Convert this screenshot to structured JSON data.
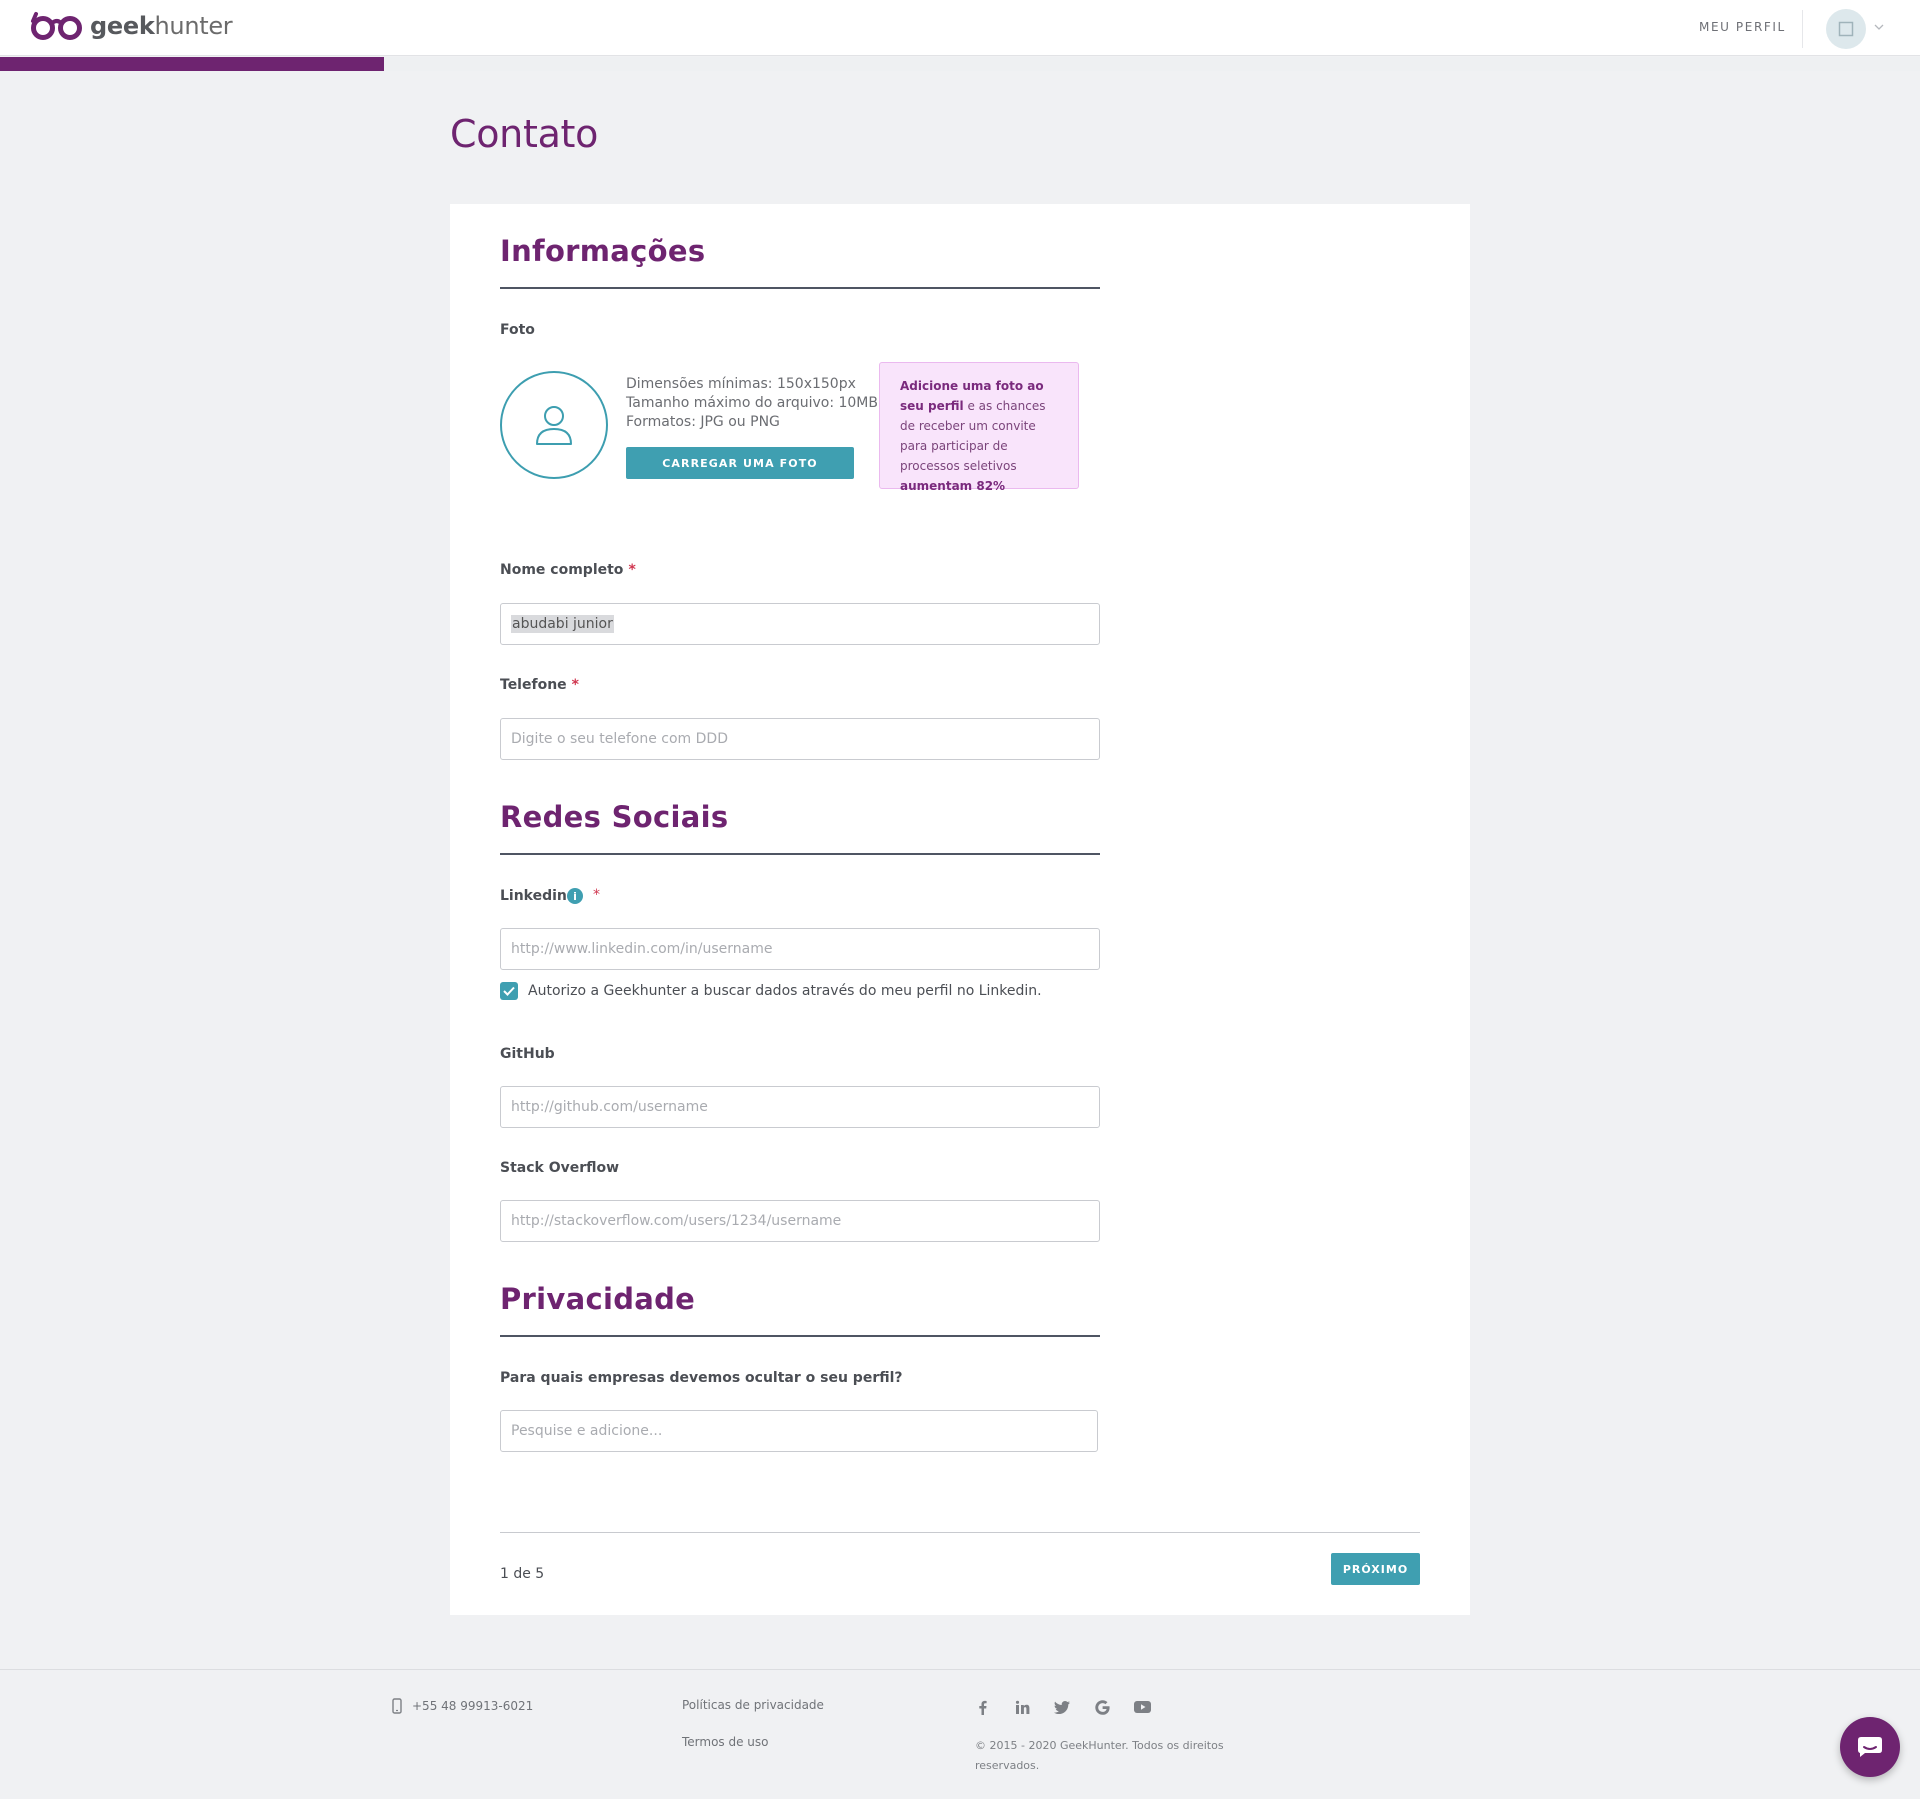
{
  "header": {
    "logo_prefix": "geek",
    "logo_suffix": "hunter",
    "nav_profile": "MEU PERFIL",
    "progress_fraction": 0.2
  },
  "page": {
    "title": "Contato"
  },
  "informacoes": {
    "title": "Informações",
    "photo_label": "Foto",
    "photo_info": [
      "Dimensões mínimas: 150x150px",
      "Tamanho máximo do arquivo: 10MB",
      "Formatos: JPG ou PNG"
    ],
    "upload_button": "CARREGAR UMA FOTO",
    "tip": {
      "bold1": "Adicione uma foto ao seu perfil",
      "text": " e as chances de receber um convite para participar de processos seletivos ",
      "bold2": "aumentam 82%"
    },
    "name_label": "Nome completo",
    "name_value": "abudabi junior",
    "phone_label": "Telefone",
    "phone_placeholder": "Digite o seu telefone com DDD",
    "required_mark": "*"
  },
  "redes": {
    "title": "Redes Sociais",
    "linkedin_label": "Linkedin",
    "linkedin_info_icon": "i",
    "linkedin_placeholder": "http://www.linkedin.com/in/username",
    "linkedin_consent": "Autorizo a Geekhunter a buscar dados através do meu perfil no Linkedin.",
    "linkedin_consent_checked": true,
    "github_label": "GitHub",
    "github_placeholder": "http://github.com/username",
    "stackoverflow_label": "Stack Overflow",
    "stackoverflow_placeholder": "http://stackoverflow.com/users/1234/username"
  },
  "privacidade": {
    "title": "Privacidade",
    "question": "Para quais empresas devemos ocultar o seu perfil?",
    "search_placeholder": "Pesquise e adicione..."
  },
  "pager": {
    "step": "1 de 5",
    "next_button": "PRÓXIMO"
  },
  "footer": {
    "phone": "+55 48 99913-6021",
    "privacy_link": "Políticas de privacidade",
    "terms_link": "Termos de uso",
    "social_icons": [
      "facebook-icon",
      "linkedin-icon",
      "twitter-icon",
      "google-icon",
      "youtube-icon"
    ],
    "copyright": "© 2015 - 2020 GeekHunter. Todos os direitos reservados."
  },
  "colors": {
    "brand": "#6e2470",
    "accent": "#3f9fb1",
    "required": "#d0364f"
  }
}
